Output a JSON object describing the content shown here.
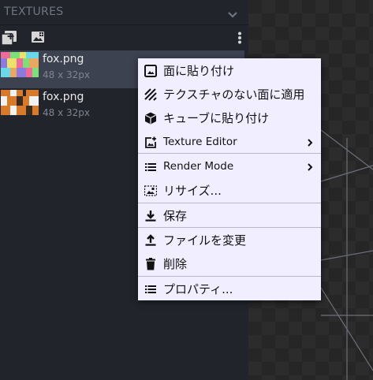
{
  "panel": {
    "title": "TEXTURES"
  },
  "textures": [
    {
      "name": "fox.png",
      "size": "48 x 32px",
      "selected": true
    },
    {
      "name": "fox.png",
      "size": "48 x 32px",
      "selected": false
    }
  ],
  "context_menu": {
    "items": [
      {
        "label": "面に貼り付け",
        "icon": "image-icon"
      },
      {
        "label": "テクスチャのない面に適用",
        "icon": "hatch-icon"
      },
      {
        "label": "キューブに貼り付け",
        "icon": "cube-icon"
      },
      {
        "label": "Texture Editor",
        "icon": "add-photo-icon",
        "submenu": true
      },
      {
        "label": "Render Mode",
        "icon": "list-icon",
        "submenu": true
      },
      {
        "label": "リサイズ...",
        "icon": "resize-photo-icon"
      },
      {
        "label": "保存",
        "icon": "save-icon"
      },
      {
        "label": "ファイルを変更",
        "icon": "upload-icon"
      },
      {
        "label": "削除",
        "icon": "trash-icon"
      },
      {
        "label": "プロパティ...",
        "icon": "list-icon"
      }
    ]
  },
  "colors": {
    "panel_bg": "#21252b",
    "selected_row": "#3d4250",
    "menu_bg": "#f1efff",
    "menu_text": "#111111"
  }
}
